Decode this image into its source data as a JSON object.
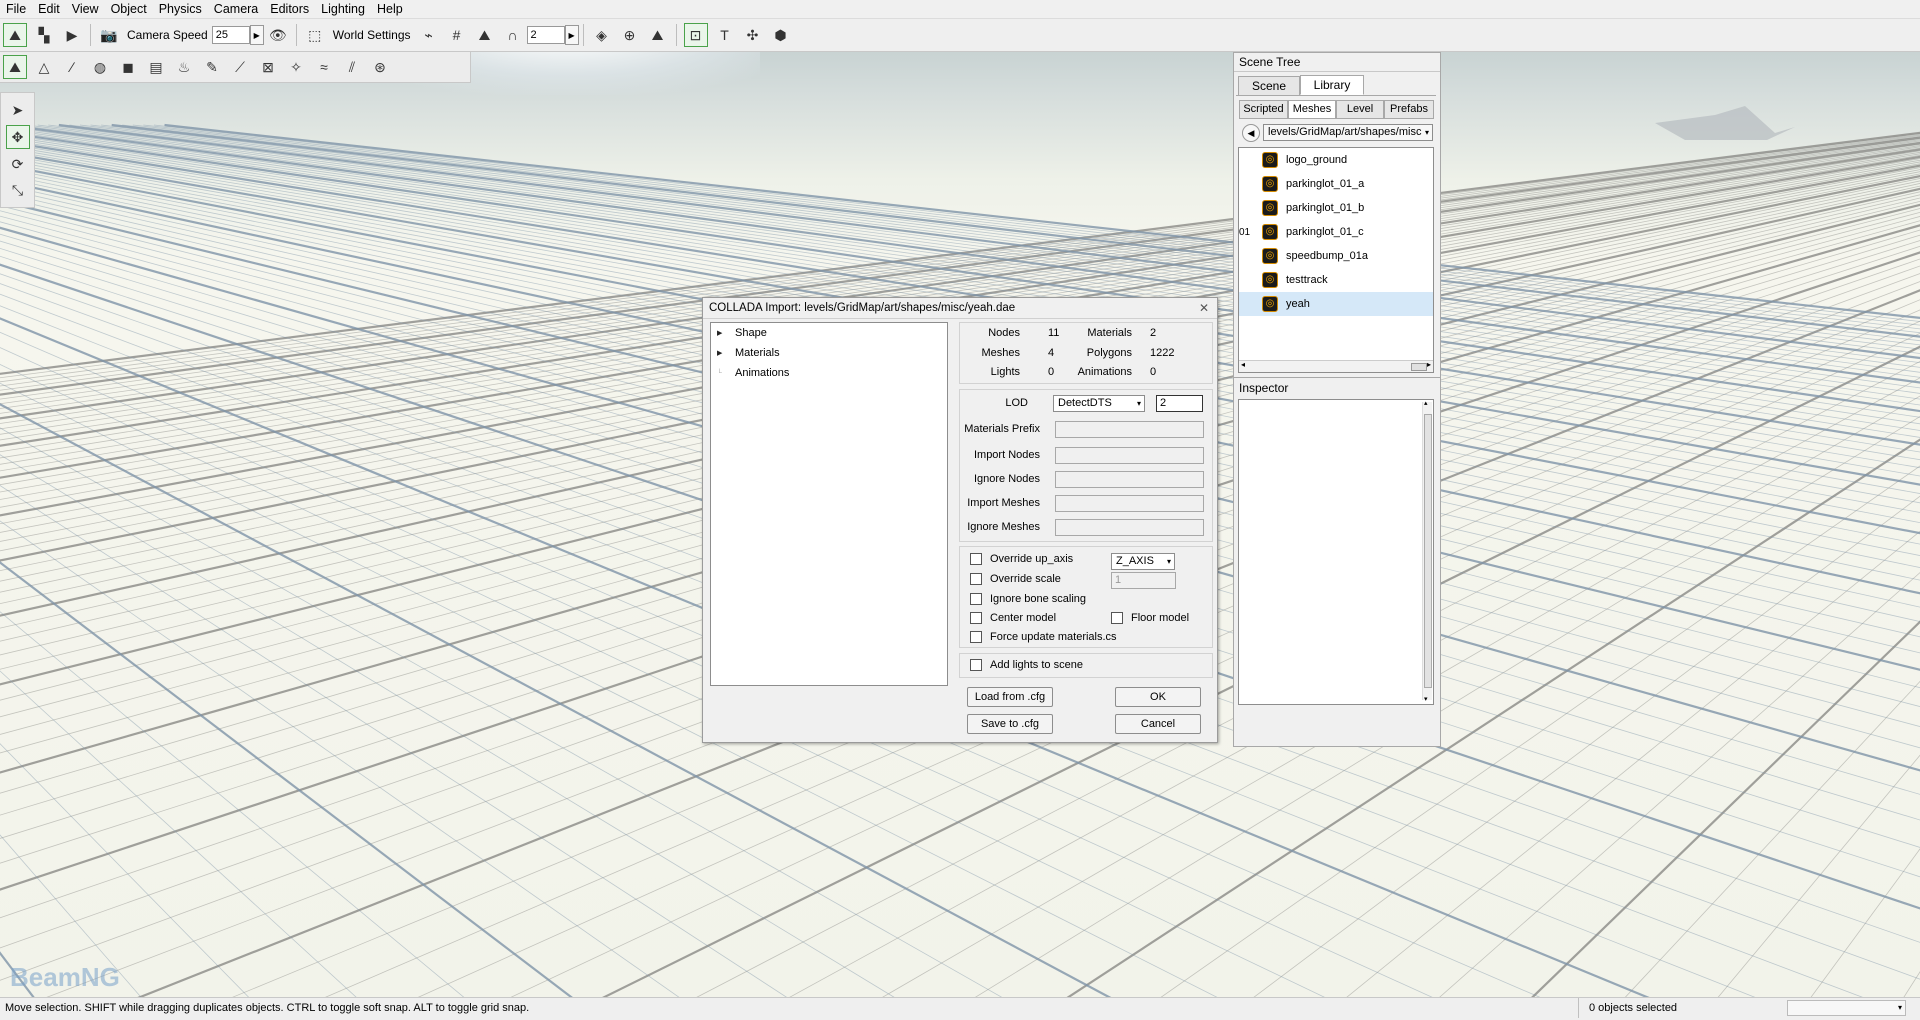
{
  "menu": [
    "File",
    "Edit",
    "View",
    "Object",
    "Physics",
    "Camera",
    "Editors",
    "Lighting",
    "Help"
  ],
  "toolbar": {
    "camera_speed_label": "Camera Speed",
    "camera_speed_value": "25",
    "world_settings_label": "World Settings",
    "snap_value": "2"
  },
  "scene_tree": {
    "title": "Scene Tree",
    "tabs": [
      "Scene",
      "Library"
    ],
    "subtabs": [
      "Scripted",
      "Meshes",
      "Level",
      "Prefabs"
    ],
    "path": "levels/GridMap/art/shapes/misc",
    "items": [
      "logo_ground",
      "parkinglot_01_a",
      "parkinglot_01_b",
      "parkinglot_01_c",
      "speedbump_01a",
      "testtrack",
      "yeah"
    ],
    "selected": "yeah",
    "clipped_prefix": "01"
  },
  "inspector": {
    "title": "Inspector"
  },
  "dialog": {
    "title": "COLLADA Import: levels/GridMap/art/shapes/misc/yeah.dae",
    "tree": [
      "Shape",
      "Materials",
      "Animations"
    ],
    "stats": {
      "nodes_label": "Nodes",
      "nodes": "11",
      "materials_label": "Materials",
      "materials": "2",
      "meshes_label": "Meshes",
      "meshes": "4",
      "polygons_label": "Polygons",
      "polygons": "1222",
      "lights_label": "Lights",
      "lights": "0",
      "animations_label": "Animations",
      "animations": "0"
    },
    "lod_label": "LOD",
    "lod_value": "DetectDTS",
    "lod_size": "2",
    "fields": [
      "Materials Prefix",
      "Import Nodes",
      "Ignore Nodes",
      "Import Meshes",
      "Ignore Meshes"
    ],
    "override_up_axis": "Override up_axis",
    "up_axis_value": "Z_AXIS",
    "override_scale": "Override scale",
    "scale_value": "1",
    "ignore_bone_scaling": "Ignore bone scaling",
    "center_model": "Center model",
    "floor_model": "Floor model",
    "force_update": "Force update materials.cs",
    "add_lights": "Add lights to scene",
    "load_cfg": "Load from .cfg",
    "save_cfg": "Save to .cfg",
    "ok": "OK",
    "cancel": "Cancel"
  },
  "status": {
    "message": "Move selection.  SHIFT while dragging duplicates objects.  CTRL to toggle soft snap.  ALT to toggle grid snap.",
    "selection": "0 objects selected"
  },
  "watermark": "BeamNG"
}
